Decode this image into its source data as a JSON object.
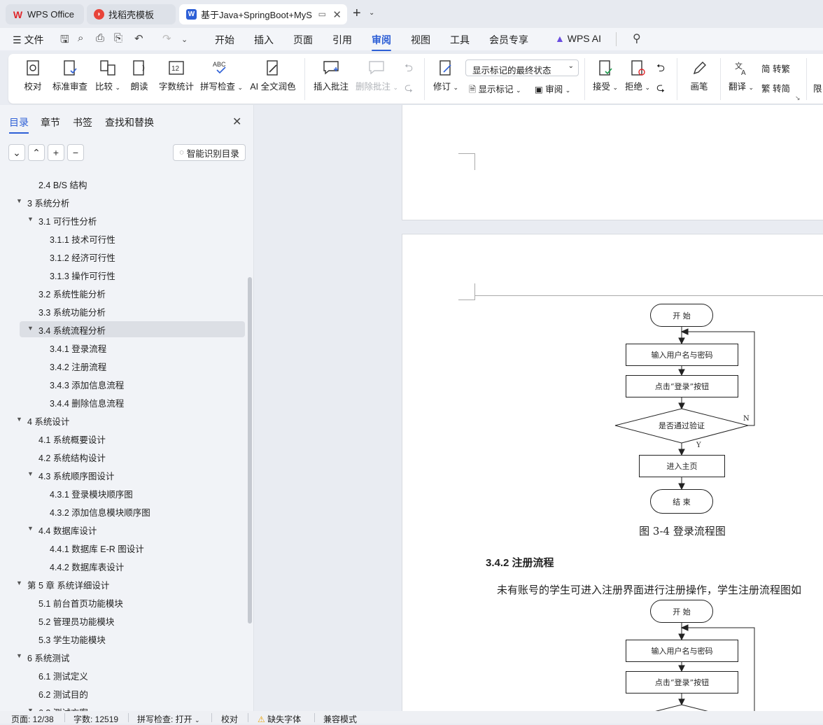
{
  "tabs": [
    {
      "label": "WPS Office",
      "icon": "wps-logo-icon"
    },
    {
      "label": "找稻壳模板",
      "icon": "docer-icon"
    },
    {
      "label": "基于Java+SpringBoot+MyS",
      "icon": "word-doc-icon"
    }
  ],
  "menu": {
    "file": "文件",
    "items": [
      "开始",
      "插入",
      "页面",
      "引用",
      "审阅",
      "视图",
      "工具",
      "会员专享",
      "WPS AI"
    ],
    "active": "审阅"
  },
  "ribbon": {
    "proofread": "校对",
    "standard_review": "标准审查",
    "compare": "比较",
    "read_aloud": "朗读",
    "word_count": "字数统计",
    "spell_check": "拼写检查",
    "ai_polish": "AI 全文润色",
    "insert_comment": "插入批注",
    "delete_comment": "删除批注",
    "revision": "修订",
    "markup_select": "显示标记的最终状态",
    "show_markup": "显示标记",
    "review": "审阅",
    "accept": "接受",
    "reject": "拒绝",
    "ink": "画笔",
    "translate": "翻译",
    "to_traditional": "简 转繁",
    "to_simplified": "繁 转简",
    "restrict": "限"
  },
  "sidebar": {
    "tabs": [
      "目录",
      "章节",
      "书签",
      "查找和替换"
    ],
    "active_tab": "目录",
    "smart_toc": "智能识别目录",
    "toc": [
      {
        "text": "2.4 B/S 结构",
        "level": 2,
        "arrow": ""
      },
      {
        "text": "3  系统分析",
        "level": 1,
        "arrow": "▼"
      },
      {
        "text": "3.1  可行性分析",
        "level": 2,
        "arrow": "▼"
      },
      {
        "text": "3.1.1  技术可行性",
        "level": 3,
        "arrow": ""
      },
      {
        "text": "3.1.2 经济可行性",
        "level": 3,
        "arrow": ""
      },
      {
        "text": "3.1.3 操作可行性",
        "level": 3,
        "arrow": ""
      },
      {
        "text": "3.2  系统性能分析",
        "level": 2,
        "arrow": ""
      },
      {
        "text": "3.3  系统功能分析",
        "level": 2,
        "arrow": ""
      },
      {
        "text": "3.4 系统流程分析",
        "level": 2,
        "arrow": "▼"
      },
      {
        "text": "3.4.1 登录流程",
        "level": 3,
        "arrow": ""
      },
      {
        "text": "3.4.2 注册流程",
        "level": 3,
        "arrow": ""
      },
      {
        "text": "3.4.3 添加信息流程",
        "level": 3,
        "arrow": ""
      },
      {
        "text": "3.4.4 删除信息流程",
        "level": 3,
        "arrow": ""
      },
      {
        "text": "4   系统设计",
        "level": 1,
        "arrow": "▼"
      },
      {
        "text": "4.1 系统概要设计",
        "level": 2,
        "arrow": ""
      },
      {
        "text": "4.2 系统结构设计",
        "level": 2,
        "arrow": ""
      },
      {
        "text": "4.3 系统顺序图设计",
        "level": 2,
        "arrow": "▼"
      },
      {
        "text": "4.3.1 登录模块顺序图",
        "level": 3,
        "arrow": ""
      },
      {
        "text": "4.3.2 添加信息模块顺序图",
        "level": 3,
        "arrow": ""
      },
      {
        "text": "4.4 数据库设计",
        "level": 2,
        "arrow": "▼"
      },
      {
        "text": "4.4.1 数据库 E-R 图设计",
        "level": 3,
        "arrow": ""
      },
      {
        "text": "4.4.2 数据库表设计",
        "level": 3,
        "arrow": ""
      },
      {
        "text": "第 5 章  系统详细设计",
        "level": 1,
        "arrow": "▼"
      },
      {
        "text": "5.1 前台首页功能模块",
        "level": 2,
        "arrow": ""
      },
      {
        "text": "5.2 管理员功能模块",
        "level": 2,
        "arrow": ""
      },
      {
        "text": "5.3 学生功能模块",
        "level": 2,
        "arrow": ""
      },
      {
        "text": "6  系统测试",
        "level": 1,
        "arrow": "▼"
      },
      {
        "text": "6.1  测试定义",
        "level": 2,
        "arrow": ""
      },
      {
        "text": "6.2  测试目的",
        "level": 2,
        "arrow": ""
      },
      {
        "text": "6.3 测试方案",
        "level": 2,
        "arrow": "▼"
      }
    ],
    "selected_index": 8
  },
  "document": {
    "flow1": {
      "start": "开 始",
      "input": "输入用户名与密码",
      "click": "点击“登录”按钮",
      "decision": "是否通过验证",
      "yes": "Y",
      "no": "N",
      "enter": "进入主页",
      "end": "结 束"
    },
    "caption": "图 3-4  登录流程图",
    "heading": "3.4.2 注册流程",
    "paragraph": "未有账号的学生可进入注册界面进行注册操作，学生注册流程图如",
    "flow2": {
      "start": "开 始",
      "input": "输入用户名与密码",
      "click": "点击“登录”按钮"
    }
  },
  "status": {
    "page": "页面: 12/38",
    "words": "字数: 12519",
    "spell": "拼写检查: 打开",
    "proof": "校对",
    "missing_font": "缺失字体",
    "compat": "兼容模式"
  }
}
